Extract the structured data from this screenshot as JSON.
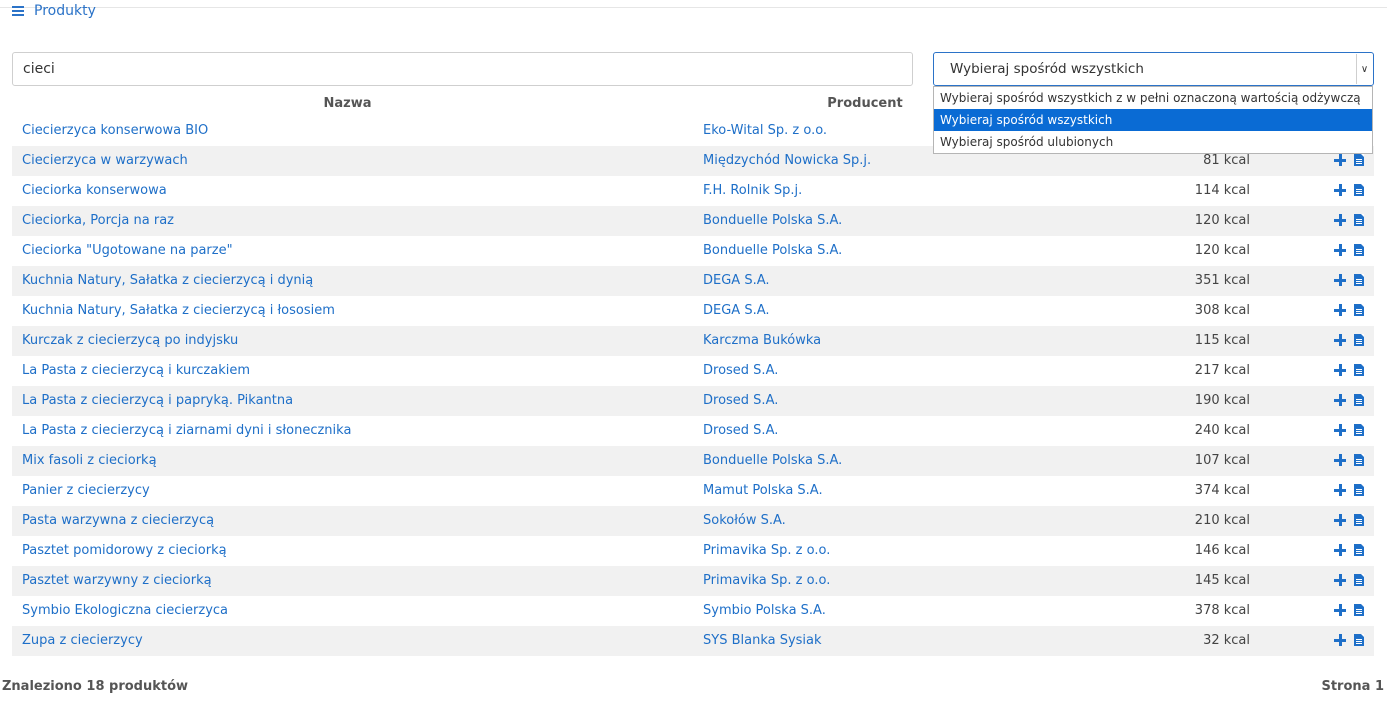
{
  "header": {
    "title": "Produkty",
    "menu_icon": "hamburger-icon"
  },
  "search": {
    "value": "cieci"
  },
  "filter": {
    "selected": "Wybieraj spośród wszystkich",
    "options": [
      "Wybieraj spośród wszystkich z w pełni oznaczoną wartością odżywczą",
      "Wybieraj spośród wszystkich",
      "Wybieraj spośród ulubionych"
    ],
    "selected_index": 1
  },
  "table": {
    "headers": {
      "name": "Nazwa",
      "producer": "Producent"
    },
    "rows": [
      {
        "name": "Ciecierzyca konserwowa BIO",
        "producer": "Eko-Wital Sp. z o.o.",
        "kcal": ""
      },
      {
        "name": "Ciecierzyca w warzywach",
        "producer": "Międzychód Nowicka Sp.j.",
        "kcal": "81 kcal"
      },
      {
        "name": "Cieciorka konserwowa",
        "producer": "F.H. Rolnik Sp.j.",
        "kcal": "114 kcal"
      },
      {
        "name": "Cieciorka, Porcja na raz",
        "producer": "Bonduelle Polska S.A.",
        "kcal": "120 kcal"
      },
      {
        "name": "Cieciorka \"Ugotowane na parze\"",
        "producer": "Bonduelle Polska S.A.",
        "kcal": "120 kcal"
      },
      {
        "name": "Kuchnia Natury, Sałatka z ciecierzycą i dynią",
        "producer": "DEGA S.A.",
        "kcal": "351 kcal"
      },
      {
        "name": "Kuchnia Natury, Sałatka z ciecierzycą i łososiem",
        "producer": "DEGA S.A.",
        "kcal": "308 kcal"
      },
      {
        "name": "Kurczak z ciecierzycą po indyjsku",
        "producer": "Karczma Bukówka",
        "kcal": "115 kcal"
      },
      {
        "name": "La Pasta z ciecierzycą i kurczakiem",
        "producer": "Drosed S.A.",
        "kcal": "217 kcal"
      },
      {
        "name": "La Pasta z ciecierzycą i papryką. Pikantna",
        "producer": "Drosed S.A.",
        "kcal": "190 kcal"
      },
      {
        "name": "La Pasta z ciecierzycą i ziarnami dyni i słonecznika",
        "producer": "Drosed S.A.",
        "kcal": "240 kcal"
      },
      {
        "name": "Mix fasoli z cieciorką",
        "producer": "Bonduelle Polska S.A.",
        "kcal": "107 kcal"
      },
      {
        "name": "Panier z ciecierzycy",
        "producer": "Mamut Polska S.A.",
        "kcal": "374 kcal"
      },
      {
        "name": "Pasta warzywna z ciecierzycą",
        "producer": "Sokołów S.A.",
        "kcal": "210 kcal"
      },
      {
        "name": "Pasztet pomidorowy z cieciorką",
        "producer": "Primavika Sp. z o.o.",
        "kcal": "146 kcal"
      },
      {
        "name": "Pasztet warzywny z cieciorką",
        "producer": "Primavika Sp. z o.o.",
        "kcal": "145 kcal"
      },
      {
        "name": "Symbio Ekologiczna ciecierzyca",
        "producer": "Symbio Polska S.A.",
        "kcal": "378 kcal"
      },
      {
        "name": "Zupa z ciecierzycy",
        "producer": "SYS Blanka Sysiak",
        "kcal": "32 kcal"
      }
    ]
  },
  "footer": {
    "found": "Znaleziono 18 produktów",
    "page": "Strona  1"
  },
  "colors": {
    "link": "#1e6fc8",
    "accent": "#2b73c8",
    "selected_option": "#0a6bd4",
    "stripe": "#f1f1f1"
  }
}
